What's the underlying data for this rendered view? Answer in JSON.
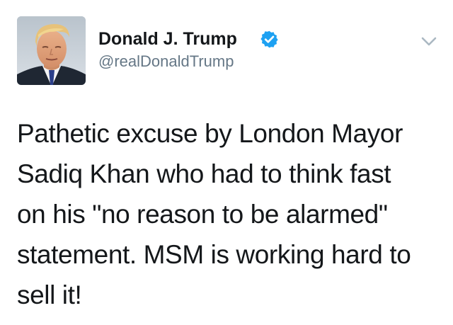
{
  "author": {
    "display_name": "Donald J. Trump",
    "handle": "@realDonaldTrump",
    "verified": true,
    "avatar_icon": "profile-photo",
    "verified_icon": "verified-badge-icon"
  },
  "actions": {
    "more_icon": "chevron-down-icon"
  },
  "tweet": {
    "lines": [
      "Pathetic excuse by London Mayor",
      "Sadiq Khan who had to think fast",
      "on his \"no reason to be alarmed\"",
      "statement. MSM is working hard to",
      "sell it!"
    ]
  },
  "colors": {
    "text": "#14171a",
    "secondary": "#657786",
    "verified_blue": "#1da1f2",
    "caret": "#aab8c2"
  }
}
